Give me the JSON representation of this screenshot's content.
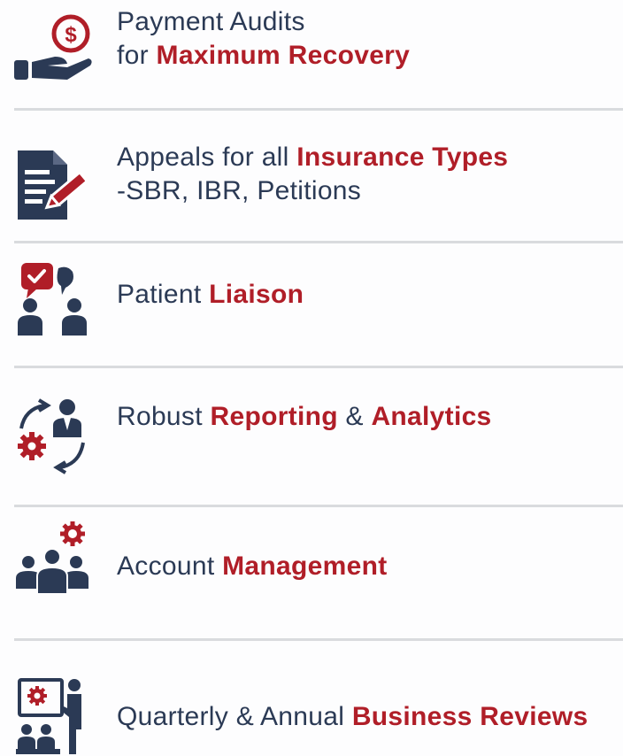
{
  "colors": {
    "navy": "#2b3a55",
    "red": "#b01e28",
    "divider": "#d9dbde",
    "background": "#fdfdfe"
  },
  "items": [
    {
      "icon": "dollar-hand-icon",
      "pre": "Payment Audits",
      "line2_pre": "for ",
      "bold": "Maximum Recovery"
    },
    {
      "icon": "document-pen-icon",
      "pre": "Appeals for all ",
      "bold": "Insurance Types",
      "line2": "-SBR, IBR, Petitions"
    },
    {
      "icon": "chat-people-icon",
      "pre": "Patient ",
      "bold": "Liaison"
    },
    {
      "icon": "analytics-cycle-icon",
      "pre": "Robust ",
      "bold": "Reporting",
      "mid": " & ",
      "bold2": "Analytics"
    },
    {
      "icon": "team-gear-icon",
      "pre": "Account ",
      "bold": "Management"
    },
    {
      "icon": "presentation-icon",
      "pre": "Quarterly & Annual ",
      "bold": "Business Reviews"
    }
  ]
}
